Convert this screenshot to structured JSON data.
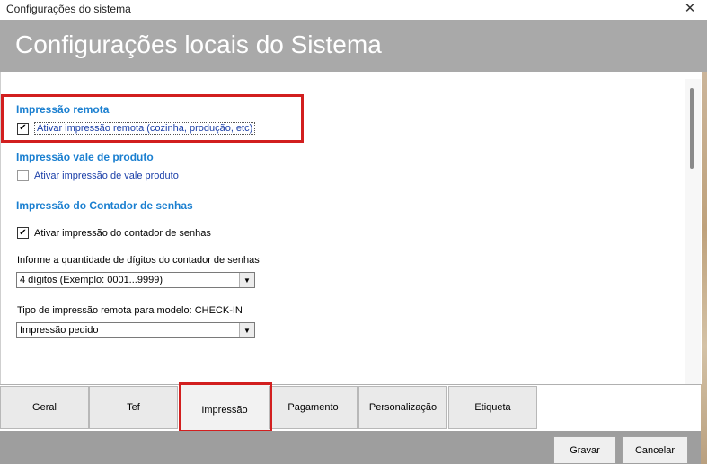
{
  "window": {
    "title": "Configurações do sistema",
    "close_glyph": "✕"
  },
  "header": {
    "title": "Configurações locais do Sistema"
  },
  "sections": {
    "remote": {
      "title": "Impressão remota",
      "checkbox_label": "Ativar impressão remota (cozinha, produção, etc)",
      "checked": true
    },
    "voucher": {
      "title": "Impressão vale de produto",
      "checkbox_label": "Ativar impressão de vale produto",
      "checked": false
    },
    "counter": {
      "title": "Impressão do Contador de senhas",
      "checkbox_label": "Ativar impressão do contador de senhas",
      "checked": true,
      "digits_label": "Informe a quantidade de dígitos do contador de senhas",
      "digits_value": "4 dígitos (Exemplo: 0001...9999)",
      "checkin_label": "Tipo de impressão remota para modelo: CHECK-IN",
      "checkin_value": "Impressão pedido"
    }
  },
  "tabs": [
    "Geral",
    "Tef",
    "Impressão",
    "Pagamento",
    "Personalização",
    "Etiqueta"
  ],
  "active_tab": "Impressão",
  "buttons": {
    "save": "Gravar",
    "cancel": "Cancelar"
  },
  "icons": {
    "check": "✔",
    "dropdown": "▼"
  },
  "colors": {
    "section_title": "#1a7fd0",
    "highlight": "#d21f1f",
    "header_bg": "#a9a9a9"
  }
}
